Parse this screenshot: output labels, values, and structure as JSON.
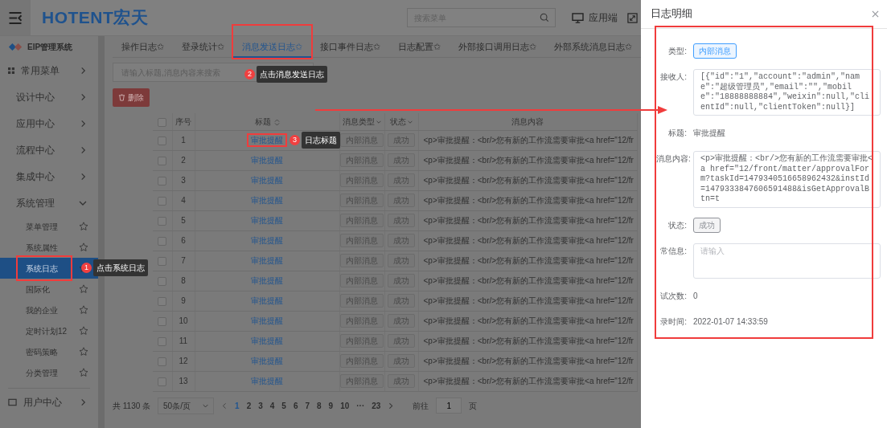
{
  "header": {
    "logo": "HOTENT宏天",
    "search": {
      "placeholder": "搜索菜单"
    },
    "app_link": "应用端"
  },
  "sidebar": {
    "title": "EIP管理系统",
    "favorites": "常用菜单",
    "groups": [
      {
        "label": "设计中心",
        "expanded": false
      },
      {
        "label": "应用中心",
        "expanded": false
      },
      {
        "label": "流程中心",
        "expanded": false
      },
      {
        "label": "集成中心",
        "expanded": false
      },
      {
        "label": "系统管理",
        "expanded": true,
        "children": [
          {
            "label": "菜单管理",
            "selected": false
          },
          {
            "label": "系统属性",
            "selected": false
          },
          {
            "label": "系统日志",
            "selected": true,
            "annotation": {
              "number": "1",
              "text": "点击系统日志"
            }
          },
          {
            "label": "国际化",
            "selected": false
          },
          {
            "label": "我的企业",
            "selected": false
          },
          {
            "label": "定时计划12",
            "selected": false
          },
          {
            "label": "密码策略",
            "selected": false
          },
          {
            "label": "分类管理",
            "selected": false
          }
        ]
      }
    ],
    "footer_item": "用户中心"
  },
  "tabs": [
    {
      "label": "操作日志✩",
      "selected": false
    },
    {
      "label": "登录统计✩",
      "selected": false
    },
    {
      "label": "消息发送日志✩",
      "selected": true,
      "annotation": {
        "number": "2",
        "text": "点击消息发送日志"
      }
    },
    {
      "label": "接口事件日志✩",
      "selected": false
    },
    {
      "label": "日志配置✩",
      "selected": false
    },
    {
      "label": "外部接口调用日志✩",
      "selected": false
    },
    {
      "label": "外部系统消息日志✩",
      "selected": false
    }
  ],
  "toolbar": {
    "search": {
      "placeholder": "请输入标题,消息内容来搜索"
    },
    "delete_button": "删除"
  },
  "table": {
    "columns": [
      {
        "label": "序号",
        "kind": "plain"
      },
      {
        "label": "标题",
        "kind": "sortable"
      },
      {
        "label": "消息类型",
        "kind": "filter"
      },
      {
        "label": "状态",
        "kind": "filter"
      },
      {
        "label": "消息内容",
        "kind": "plain"
      }
    ],
    "all_checked": false,
    "rows": [
      {
        "checked": false,
        "index": "1",
        "title": "审批提醒",
        "annotation": {
          "number": "3",
          "text": "日志标题"
        },
        "type": "内部消息",
        "status": "成功",
        "content": "<p>审批提醒：<br/>您有新的工作流需要审批<a href=\"12/fr"
      },
      {
        "checked": false,
        "index": "2",
        "title": "审批提醒",
        "type": "内部消息",
        "status": "成功",
        "content": "<p>审批提醒：<br/>您有新的工作流需要审批<a href=\"12/fr"
      },
      {
        "checked": false,
        "index": "3",
        "title": "审批提醒",
        "type": "内部消息",
        "status": "成功",
        "content": "<p>审批提醒：<br/>您有新的工作流需要审批<a href=\"12/fr"
      },
      {
        "checked": false,
        "index": "4",
        "title": "审批提醒",
        "type": "内部消息",
        "status": "成功",
        "content": "<p>审批提醒：<br/>您有新的工作流需要审批<a href=\"12/fr"
      },
      {
        "checked": false,
        "index": "5",
        "title": "审批提醒",
        "type": "内部消息",
        "status": "成功",
        "content": "<p>审批提醒：<br/>您有新的工作流需要审批<a href=\"12/fr"
      },
      {
        "checked": false,
        "index": "6",
        "title": "审批提醒",
        "type": "内部消息",
        "status": "成功",
        "content": "<p>审批提醒：<br/>您有新的工作流需要审批<a href=\"12/fr"
      },
      {
        "checked": false,
        "index": "7",
        "title": "审批提醒",
        "type": "内部消息",
        "status": "成功",
        "content": "<p>审批提醒：<br/>您有新的工作流需要审批<a href=\"12/fr"
      },
      {
        "checked": false,
        "index": "8",
        "title": "审批提醒",
        "type": "内部消息",
        "status": "成功",
        "content": "<p>审批提醒：<br/>您有新的工作流需要审批<a href=\"12/fr"
      },
      {
        "checked": false,
        "index": "9",
        "title": "审批提醒",
        "type": "内部消息",
        "status": "成功",
        "content": "<p>审批提醒：<br/>您有新的工作流需要审批<a href=\"12/fr"
      },
      {
        "checked": false,
        "index": "10",
        "title": "审批提醒",
        "type": "内部消息",
        "status": "成功",
        "content": "<p>审批提醒：<br/>您有新的工作流需要审批<a href=\"12/fr"
      },
      {
        "checked": false,
        "index": "11",
        "title": "审批提醒",
        "type": "内部消息",
        "status": "成功",
        "content": "<p>审批提醒：<br/>您有新的工作流需要审批<a href=\"12/fr"
      },
      {
        "checked": false,
        "index": "12",
        "title": "审批提醒",
        "type": "内部消息",
        "status": "成功",
        "content": "<p>审批提醒：<br/>您有新的工作流需要审批<a href=\"12/fr"
      },
      {
        "checked": false,
        "index": "13",
        "title": "审批提醒",
        "type": "内部消息",
        "status": "成功",
        "content": "<p>审批提醒：<br/>您有新的工作流需要审批<a href=\"12/fr"
      }
    ]
  },
  "pagination": {
    "total": "共 1130 条",
    "page_size": "50条/页",
    "pages": [
      {
        "label": "1",
        "selected": true
      },
      {
        "label": "2",
        "selected": false
      },
      {
        "label": "3",
        "selected": false
      },
      {
        "label": "4",
        "selected": false
      },
      {
        "label": "5",
        "selected": false
      },
      {
        "label": "6",
        "selected": false
      },
      {
        "label": "7",
        "selected": false
      },
      {
        "label": "8",
        "selected": false
      },
      {
        "label": "9",
        "selected": false
      },
      {
        "label": "10",
        "selected": false
      },
      {
        "label": "···",
        "selected": false
      },
      {
        "label": "23",
        "selected": false
      }
    ],
    "goto_label": "前往",
    "goto_value": "1",
    "goto_unit": "页"
  },
  "drawer": {
    "title": "日志明细",
    "fields": [
      {
        "label": "类型:",
        "kind": "tag",
        "value": "内部消息",
        "color": "#409eff"
      },
      {
        "label": "接收人:",
        "kind": "textarea",
        "value": "[{\"id\":\"1\",\"account\":\"admin\",\"name\":\"超级管理员\",\"email\":\"\",\"mobile\":\"18888888884\",\"weixin\":null,\"clientId\":null,\"clientToken\":null}]"
      },
      {
        "label": "标题:",
        "kind": "text",
        "value": "审批提醒"
      },
      {
        "label": "消息内容:",
        "kind": "textarea",
        "value": "<p>审批提醒：<br/>您有新的工作流需要审批<a href=\"12/front/matter/approvalForm?taskId=1479340516658962432&instId=1479333847606591488&isGetApprovalBtn=t"
      },
      {
        "label": "状态:",
        "kind": "tag",
        "value": "成功",
        "color": "#909399"
      },
      {
        "label": "常信息:",
        "kind": "textarea",
        "placeholder": "请输入"
      },
      {
        "label": "试次数:",
        "kind": "text",
        "value": "0"
      },
      {
        "label": "录时间:",
        "kind": "text",
        "value": "2022-01-07 14:33:59"
      }
    ]
  }
}
